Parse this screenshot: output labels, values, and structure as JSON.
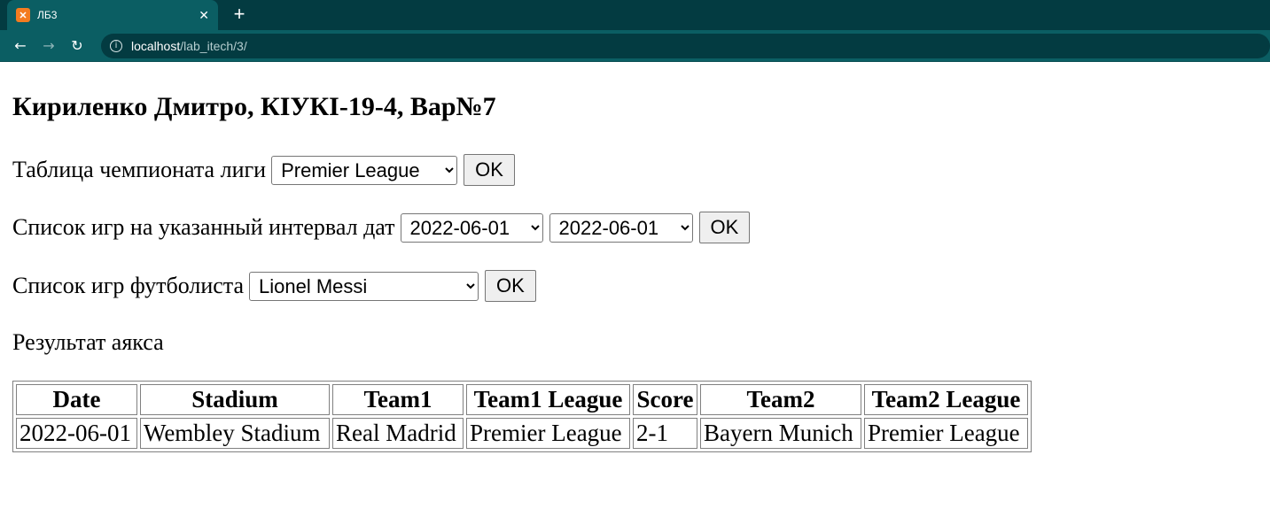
{
  "browser": {
    "tab_icon": "xampp-icon",
    "tab_title": "ЛБ3",
    "close_glyph": "✕",
    "new_tab_glyph": "+",
    "url_host": "localhost",
    "url_path": "/lab_itech/3/"
  },
  "page": {
    "heading": "Кириленко Дмитро, КІУКІ-19-4, Вар№7",
    "league_form": {
      "label": "Таблица чемпионата лиги",
      "selected": "Premier League",
      "button": "OK"
    },
    "dates_form": {
      "label": "Список игр на указанный интервал дат",
      "from": "2022-06-01",
      "to": "2022-06-01",
      "button": "OK"
    },
    "player_form": {
      "label": "Список игр футболиста",
      "selected": "Lionel Messi",
      "button": "OK"
    },
    "ajax_result_label": "Результат аякса"
  },
  "results_table": {
    "headers": [
      "Date",
      "Stadium",
      "Team1",
      "Team1 League",
      "Score",
      "Team2",
      "Team2 League"
    ],
    "rows": [
      [
        "2022-06-01",
        "Wembley Stadium",
        "Real Madrid",
        "Premier League",
        "2-1",
        "Bayern Munich",
        "Premier League"
      ]
    ]
  }
}
